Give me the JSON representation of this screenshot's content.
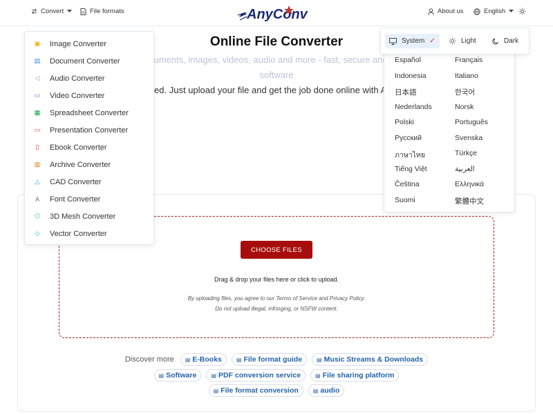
{
  "header": {
    "convert_label": "Convert",
    "file_formats_label": "File formats",
    "logo_text": "AnyConv",
    "about_label": "About us",
    "language_label": "English"
  },
  "hero": {
    "title": "Online File Converter",
    "subtitle_line1": "Convert documents, images, videos, audio and more - fast, secure and 100% free. No software",
    "subtitle_line2": "needed. Just upload your file and get the job done online with AnyConv."
  },
  "upload": {
    "choose_label": "CHOOSE FILES",
    "drag_text": "Drag & drop your files here or click to upload.",
    "terms_line1": "By uploading files, you agree to our Terms of Service and Privacy Policy.",
    "terms_line2": "Do not upload illegal, infringing, or NSFW content."
  },
  "discover": {
    "label": "Discover more",
    "row1": [
      "E-Books",
      "File format guide",
      "Music Streams & Downloads"
    ],
    "row2": [
      "Software",
      "PDF conversion service",
      "File sharing platform"
    ],
    "row3": [
      "File format conversion",
      "audio"
    ]
  },
  "convert_menu": {
    "items": [
      {
        "label": "Image Converter",
        "icon": "image-icon",
        "color": "#e8b100"
      },
      {
        "label": "Document Converter",
        "icon": "document-icon",
        "color": "#3b82f6"
      },
      {
        "label": "Audio Converter",
        "icon": "audio-icon",
        "color": "#8e9aab"
      },
      {
        "label": "Video Converter",
        "icon": "video-icon",
        "color": "#8b5cf6"
      },
      {
        "label": "Spreadsheet Converter",
        "icon": "spreadsheet-icon",
        "color": "#16a34a"
      },
      {
        "label": "Presentation Converter",
        "icon": "presentation-icon",
        "color": "#ef4444"
      },
      {
        "label": "Ebook Converter",
        "icon": "ebook-icon",
        "color": "#dc2626"
      },
      {
        "label": "Archive Converter",
        "icon": "archive-icon",
        "color": "#d97706"
      },
      {
        "label": "CAD Converter",
        "icon": "cad-icon",
        "color": "#0ea5e9"
      },
      {
        "label": "Font Converter",
        "icon": "font-icon",
        "color": "#6b7280"
      },
      {
        "label": "3D Mesh Converter",
        "icon": "mesh-icon",
        "color": "#14b8a6"
      },
      {
        "label": "Vector Converter",
        "icon": "vector-icon",
        "color": "#06b6d4"
      }
    ]
  },
  "languages": {
    "left": [
      "Español",
      "Indonesia",
      "日本語",
      "Nederlands",
      "Polski",
      "Русский",
      "ภาษาไทย",
      "Tiếng Việt",
      "Čeština",
      "Suomi"
    ],
    "right": [
      "Français",
      "Italiano",
      "한국어",
      "Norsk",
      "Português",
      "Svenska",
      "Türkçe",
      "العربية",
      "Ελληνικά",
      "繁體中文"
    ]
  },
  "theme": {
    "system_label": "System",
    "system_check": "✓",
    "light_label": "Light",
    "dark_label": "Dark"
  },
  "colors": {
    "brand_red": "#a70d0d",
    "logo_navy": "#1b2a78",
    "link_blue": "#2563a8"
  }
}
